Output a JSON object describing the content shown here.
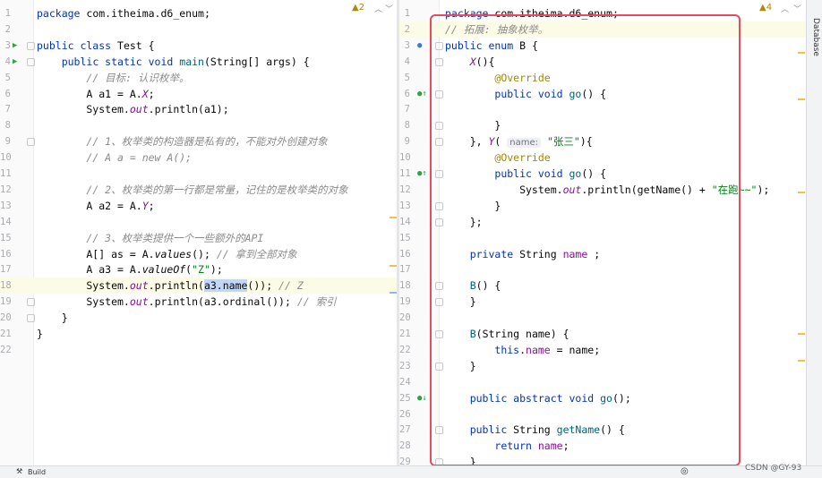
{
  "left_editor": {
    "warnings": "2",
    "lines": [
      {
        "n": "1",
        "t": [
          [
            "kw",
            "package"
          ],
          [
            "",
            " com.itheima.d6_enum;"
          ]
        ]
      },
      {
        "n": "2",
        "t": []
      },
      {
        "n": "3",
        "t": [
          [
            "kw",
            "public class"
          ],
          [
            "",
            " Test {"
          ]
        ],
        "run": true
      },
      {
        "n": "4",
        "t": [
          [
            "",
            "    "
          ],
          [
            "kw",
            "public static void"
          ],
          [
            "",
            " "
          ],
          [
            "mth",
            "main"
          ],
          [
            "",
            "(String[] args) {"
          ]
        ],
        "run": true
      },
      {
        "n": "5",
        "t": [
          [
            "",
            "        "
          ],
          [
            "cm",
            "// 目标: 认识枚举。"
          ]
        ]
      },
      {
        "n": "6",
        "t": [
          [
            "",
            "        A a1 = A."
          ],
          [
            "fldi",
            "X"
          ],
          [
            "",
            ";"
          ]
        ]
      },
      {
        "n": "7",
        "t": [
          [
            "",
            "        System."
          ],
          [
            "fldi",
            "out"
          ],
          [
            "",
            ".println(a1);"
          ]
        ]
      },
      {
        "n": "8",
        "t": []
      },
      {
        "n": "9",
        "t": [
          [
            "",
            "        "
          ],
          [
            "cm",
            "// 1、枚举类的构造器是私有的，不能对外创建对象"
          ]
        ]
      },
      {
        "n": "10",
        "t": [
          [
            "",
            "        "
          ],
          [
            "cm",
            "// A a = new A();"
          ]
        ]
      },
      {
        "n": "11",
        "t": []
      },
      {
        "n": "12",
        "t": [
          [
            "",
            "        "
          ],
          [
            "cm",
            "// 2、枚举类的第一行都是常量，记住的是枚举类的对象"
          ]
        ]
      },
      {
        "n": "13",
        "t": [
          [
            "",
            "        A a2 = A."
          ],
          [
            "fldi",
            "Y"
          ],
          [
            "",
            ";"
          ]
        ]
      },
      {
        "n": "14",
        "t": []
      },
      {
        "n": "15",
        "t": [
          [
            "",
            "        "
          ],
          [
            "cm",
            "// 3、枚举类提供一个一些额外的API"
          ]
        ]
      },
      {
        "n": "16",
        "t": [
          [
            "",
            "        A[] as = A."
          ],
          [
            "it",
            "values"
          ],
          [
            "",
            "(); "
          ],
          [
            "cm",
            "// 拿到全部对象"
          ]
        ]
      },
      {
        "n": "17",
        "t": [
          [
            "",
            "        A a3 = A."
          ],
          [
            "it",
            "valueOf"
          ],
          [
            "",
            "("
          ],
          [
            "str",
            "\"Z\""
          ],
          [
            "",
            ");"
          ]
        ]
      },
      {
        "n": "18",
        "t": [
          [
            "",
            "        System."
          ],
          [
            "fldi",
            "out"
          ],
          [
            "",
            ".println("
          ],
          [
            "sel",
            "a3.name"
          ],
          [
            "",
            "()); "
          ],
          [
            "cm",
            "// Z"
          ]
        ],
        "hl": true
      },
      {
        "n": "19",
        "t": [
          [
            "",
            "        System."
          ],
          [
            "fldi",
            "out"
          ],
          [
            "",
            ".println(a3.ordinal()); "
          ],
          [
            "cm",
            "// 索引"
          ]
        ]
      },
      {
        "n": "20",
        "t": [
          [
            "",
            "    }"
          ]
        ]
      },
      {
        "n": "21",
        "t": [
          [
            "",
            "}"
          ]
        ]
      },
      {
        "n": "22",
        "t": []
      }
    ]
  },
  "right_editor": {
    "warnings": "4",
    "lines": [
      {
        "n": "1",
        "t": [
          [
            "kw",
            "package"
          ],
          [
            "",
            " com.itheima.d6_enum;"
          ]
        ]
      },
      {
        "n": "2",
        "t": [
          [
            "cm",
            "// 拓展: 抽象枚举。"
          ]
        ],
        "hl": true
      },
      {
        "n": "3",
        "t": [
          [
            "kw",
            "public enum"
          ],
          [
            "",
            " B {"
          ]
        ]
      },
      {
        "n": "4",
        "t": [
          [
            "",
            "    "
          ],
          [
            "fldi",
            "X"
          ],
          [
            "",
            "(){"
          ]
        ]
      },
      {
        "n": "5",
        "t": [
          [
            "",
            "        "
          ],
          [
            "an",
            "@Override"
          ]
        ]
      },
      {
        "n": "6",
        "t": [
          [
            "",
            "        "
          ],
          [
            "kw",
            "public void"
          ],
          [
            "",
            " "
          ],
          [
            "mth",
            "go"
          ],
          [
            "",
            "() {"
          ]
        ]
      },
      {
        "n": "7",
        "t": []
      },
      {
        "n": "8",
        "t": [
          [
            "",
            "        }"
          ]
        ]
      },
      {
        "n": "9",
        "t": [
          [
            "",
            "    }, "
          ],
          [
            "fldi",
            "Y"
          ],
          [
            "",
            "( "
          ],
          [
            "hint",
            "name:"
          ],
          [
            "",
            " "
          ],
          [
            "str",
            "\"张三\""
          ],
          [
            "",
            "){"
          ]
        ]
      },
      {
        "n": "10",
        "t": [
          [
            "",
            "        "
          ],
          [
            "an",
            "@Override"
          ]
        ]
      },
      {
        "n": "11",
        "t": [
          [
            "",
            "        "
          ],
          [
            "kw",
            "public void"
          ],
          [
            "",
            " "
          ],
          [
            "mth",
            "go"
          ],
          [
            "",
            "() {"
          ]
        ]
      },
      {
        "n": "12",
        "t": [
          [
            "",
            "            System."
          ],
          [
            "fldi",
            "out"
          ],
          [
            "",
            ".println(getName() + "
          ],
          [
            "str",
            "\"在跑~~\""
          ],
          [
            "",
            ");"
          ]
        ]
      },
      {
        "n": "13",
        "t": [
          [
            "",
            "        }"
          ]
        ]
      },
      {
        "n": "14",
        "t": [
          [
            "",
            "    };"
          ]
        ]
      },
      {
        "n": "15",
        "t": []
      },
      {
        "n": "16",
        "t": [
          [
            "",
            "    "
          ],
          [
            "kw",
            "private"
          ],
          [
            "",
            " String "
          ],
          [
            "fld",
            "name"
          ],
          [
            "",
            " ;"
          ]
        ]
      },
      {
        "n": "17",
        "t": []
      },
      {
        "n": "18",
        "t": [
          [
            "",
            "    "
          ],
          [
            "mth",
            "B"
          ],
          [
            "",
            "() {"
          ]
        ]
      },
      {
        "n": "19",
        "t": [
          [
            "",
            "    }"
          ]
        ]
      },
      {
        "n": "20",
        "t": []
      },
      {
        "n": "21",
        "t": [
          [
            "",
            "    "
          ],
          [
            "mth",
            "B"
          ],
          [
            "",
            "(String name) {"
          ]
        ]
      },
      {
        "n": "22",
        "t": [
          [
            "",
            "        "
          ],
          [
            "kw",
            "this"
          ],
          [
            "",
            "."
          ],
          [
            "fld",
            "name"
          ],
          [
            "",
            " = name;"
          ]
        ]
      },
      {
        "n": "23",
        "t": [
          [
            "",
            "    }"
          ]
        ]
      },
      {
        "n": "24",
        "t": []
      },
      {
        "n": "25",
        "t": [
          [
            "",
            "    "
          ],
          [
            "kw",
            "public abstract void"
          ],
          [
            "",
            " "
          ],
          [
            "mth",
            "go"
          ],
          [
            "",
            "();"
          ]
        ]
      },
      {
        "n": "26",
        "t": []
      },
      {
        "n": "27",
        "t": [
          [
            "",
            "    "
          ],
          [
            "kw",
            "public"
          ],
          [
            "",
            " String "
          ],
          [
            "mth",
            "getName"
          ],
          [
            "",
            "() {"
          ]
        ]
      },
      {
        "n": "28",
        "t": [
          [
            "",
            "        "
          ],
          [
            "kw",
            "return"
          ],
          [
            "",
            " "
          ],
          [
            "fld",
            "name"
          ],
          [
            "",
            ";"
          ]
        ]
      },
      {
        "n": "29",
        "t": [
          [
            "",
            "    }"
          ]
        ]
      }
    ]
  },
  "statusbar": {
    "build_label": "Build"
  },
  "tool_window": {
    "database_label": "Database"
  },
  "watermark": {
    "text": "CSDN @GY-93"
  },
  "colors": {
    "highlight_border": "#e84a5f",
    "keyword": "#0033b3",
    "comment": "#8c8c8c",
    "string": "#067d17"
  }
}
